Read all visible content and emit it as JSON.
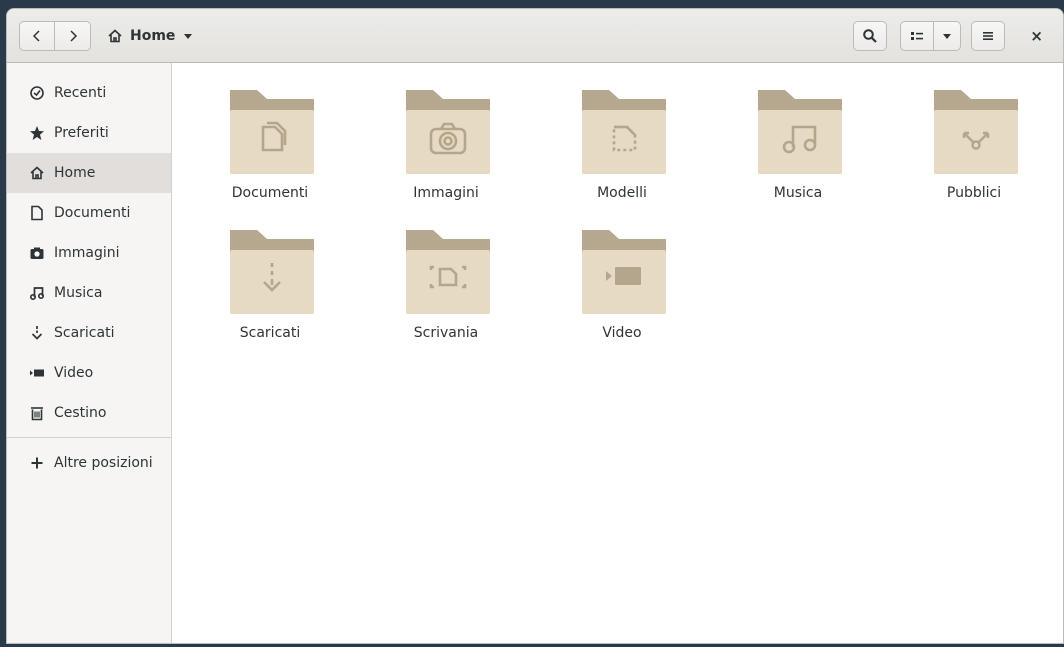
{
  "window": {
    "title": "Home"
  },
  "header": {
    "back_icon": "chevron-left-icon",
    "forward_icon": "chevron-right-icon",
    "location_label": "Home",
    "search_icon": "search-icon",
    "view_icon": "list-view-icon",
    "menu_icon": "hamburger-menu-icon",
    "close_label": "×"
  },
  "sidebar": {
    "items": [
      {
        "label": "Recenti",
        "icon": "clock-icon"
      },
      {
        "label": "Preferiti",
        "icon": "star-icon"
      },
      {
        "label": "Home",
        "icon": "home-icon",
        "active": true
      },
      {
        "label": "Documenti",
        "icon": "document-icon"
      },
      {
        "label": "Immagini",
        "icon": "camera-icon"
      },
      {
        "label": "Musica",
        "icon": "music-icon"
      },
      {
        "label": "Scaricati",
        "icon": "download-icon"
      },
      {
        "label": "Video",
        "icon": "video-icon"
      },
      {
        "label": "Cestino",
        "icon": "trash-icon"
      }
    ],
    "other_locations": {
      "label": "Altre posizioni",
      "icon": "plus-icon"
    }
  },
  "folders": [
    {
      "label": "Documenti",
      "icon": "document-icon"
    },
    {
      "label": "Immagini",
      "icon": "camera-icon"
    },
    {
      "label": "Modelli",
      "icon": "template-icon"
    },
    {
      "label": "Musica",
      "icon": "music-icon"
    },
    {
      "label": "Pubblici",
      "icon": "share-icon"
    },
    {
      "label": "Scaricati",
      "icon": "download-icon"
    },
    {
      "label": "Scrivania",
      "icon": "desktop-icon"
    },
    {
      "label": "Video",
      "icon": "video-icon"
    }
  ],
  "colors": {
    "folder_back": "#b5a88e",
    "folder_front": "#e6dac4",
    "folder_emblem": "#b4a68c"
  }
}
